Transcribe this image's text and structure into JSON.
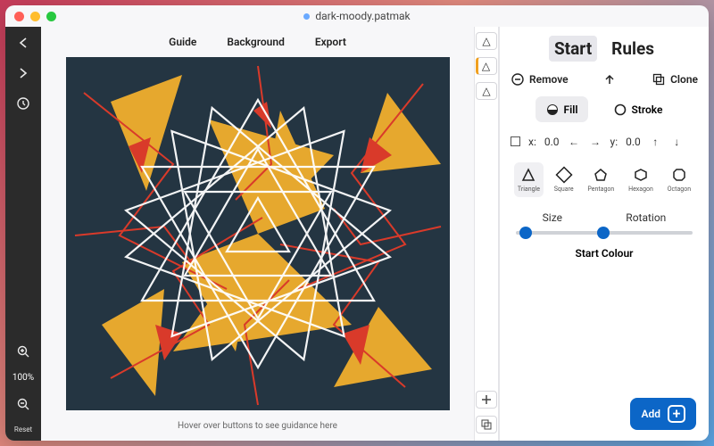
{
  "window": {
    "filename": "dark-moody.patmak",
    "modified": true
  },
  "left_toolbar": {
    "undo": "undo",
    "redo": "redo",
    "history": "history",
    "zoom_in": "zoom-in",
    "zoom_out": "zoom-out",
    "zoom_label": "100%",
    "reset": "Reset"
  },
  "top_tabs": {
    "guide": "Guide",
    "background": "Background",
    "export": "Export"
  },
  "hint": "Hover over buttons to see guidance here",
  "layers": {
    "items": [
      "△",
      "△",
      "△"
    ],
    "selected_index": 1,
    "add": "add-layer",
    "duplicate": "duplicate-layer"
  },
  "panel": {
    "tabs": {
      "start": "Start",
      "rules": "Rules",
      "active": "start"
    },
    "remove": "Remove",
    "clone": "Clone",
    "fill": "Fill",
    "stroke": "Stroke",
    "style_active": "fill",
    "coords": {
      "x_label": "x:",
      "x_value": "0.0",
      "y_label": "y:",
      "y_value": "0.0"
    },
    "shapes": {
      "options": [
        {
          "key": "triangle",
          "label": "Triangle"
        },
        {
          "key": "square",
          "label": "Square"
        },
        {
          "key": "pentagon",
          "label": "Pentagon"
        },
        {
          "key": "hexagon",
          "label": "Hexagon"
        },
        {
          "key": "octagon",
          "label": "Octagon"
        }
      ],
      "selected": "triangle"
    },
    "sliders": {
      "size_label": "Size",
      "size_value": 0.03,
      "rotation_label": "Rotation",
      "rotation_value": 0.47
    },
    "start_colour_label": "Start Colour",
    "add_button": "Add"
  },
  "canvas": {
    "bg": "#243542",
    "accent1": "#e6a82e",
    "accent2": "#d93a2a",
    "guide": "#ffffff"
  }
}
